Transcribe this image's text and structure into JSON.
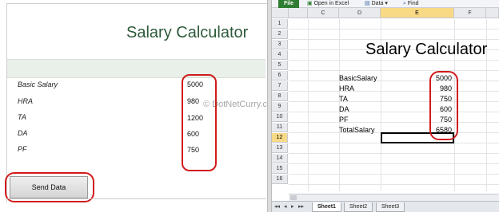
{
  "form": {
    "title": "Salary Calculator",
    "fields": [
      {
        "label": "Basic Salary",
        "value": "5000"
      },
      {
        "label": "HRA",
        "value": "980"
      },
      {
        "label": "TA",
        "value": "1200"
      },
      {
        "label": "DA",
        "value": "600"
      },
      {
        "label": "PF",
        "value": "750"
      }
    ],
    "send_button": "Send Data"
  },
  "watermark": "© DotNetCurry.com",
  "excel": {
    "ribbon": {
      "file": "File",
      "open_in_excel": "Open in Excel",
      "data": "Data",
      "find": "Find"
    },
    "columns": [
      "C",
      "D",
      "E",
      "F"
    ],
    "selected_column": "E",
    "rows": [
      "1",
      "2",
      "3",
      "4",
      "5",
      "6",
      "7",
      "8",
      "9",
      "10",
      "11",
      "12",
      "13",
      "14",
      "15",
      "16"
    ],
    "selected_row": "12",
    "title": "Salary Calculator",
    "table": [
      {
        "label": "BasicSalary",
        "value": "5000"
      },
      {
        "label": "HRA",
        "value": "980"
      },
      {
        "label": "TA",
        "value": "750"
      },
      {
        "label": "DA",
        "value": "600"
      },
      {
        "label": "PF",
        "value": "750"
      },
      {
        "label": "TotalSalary",
        "value": "6580"
      }
    ],
    "sheets": [
      "Sheet1",
      "Sheet2",
      "Sheet3"
    ],
    "nav": [
      "◂◂",
      "◂",
      "▸",
      "▸▸"
    ]
  },
  "colors": {
    "title_green": "#2e5a3a",
    "highlight_red": "#d11a1a",
    "excel_green": "#2f7d32",
    "selection": "#f8d985"
  }
}
